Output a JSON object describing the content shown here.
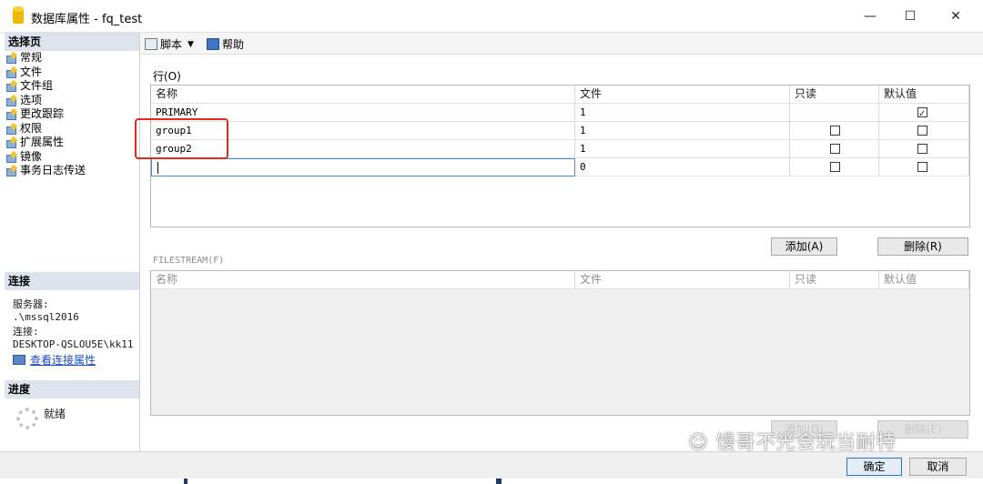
{
  "window": {
    "title": "数据库属性 - fq_test",
    "minimize": "—",
    "maximize": "☐",
    "close": "✕"
  },
  "sidebar": {
    "select_page_header": "选择页",
    "pages": [
      "常规",
      "文件",
      "文件组",
      "选项",
      "更改跟踪",
      "权限",
      "扩展属性",
      "镜像",
      "事务日志传送"
    ],
    "connection_header": "连接",
    "server_label": "服务器:",
    "server_value": ".\\mssql2016",
    "connection_label": "连接:",
    "connection_value": "DESKTOP-QSLOU5E\\kk11",
    "view_connection_link": "查看连接属性",
    "progress_header": "进度",
    "progress_status": "就绪"
  },
  "toolbar": {
    "script_label": "脚本",
    "help_label": "帮助"
  },
  "rows_section": {
    "label": "行(O)",
    "columns": [
      "名称",
      "文件",
      "只读",
      "默认值"
    ],
    "rows": [
      {
        "name": "PRIMARY",
        "files": "1",
        "readonly": false,
        "default": true
      },
      {
        "name": "group1",
        "files": "1",
        "readonly": false,
        "default": false
      },
      {
        "name": "group2",
        "files": "1",
        "readonly": false,
        "default": false
      },
      {
        "name": "",
        "files": "0",
        "readonly": false,
        "default": false
      }
    ],
    "add_button": "添加(A)",
    "remove_button": "删除(R)"
  },
  "filestream_section": {
    "label": "FILESTREAM(F)",
    "columns": [
      "名称",
      "文件",
      "只读",
      "默认值"
    ],
    "add_button": "添加(D)",
    "remove_button": "删除(E)"
  },
  "footer": {
    "ok_button": "确定",
    "cancel_button": "取消"
  },
  "watermark": "馒哥不光会玩当耐特",
  "colors": {
    "accent": "#2b73d2",
    "highlight_box": "#e8281e",
    "section_header": "#dde4ee"
  }
}
